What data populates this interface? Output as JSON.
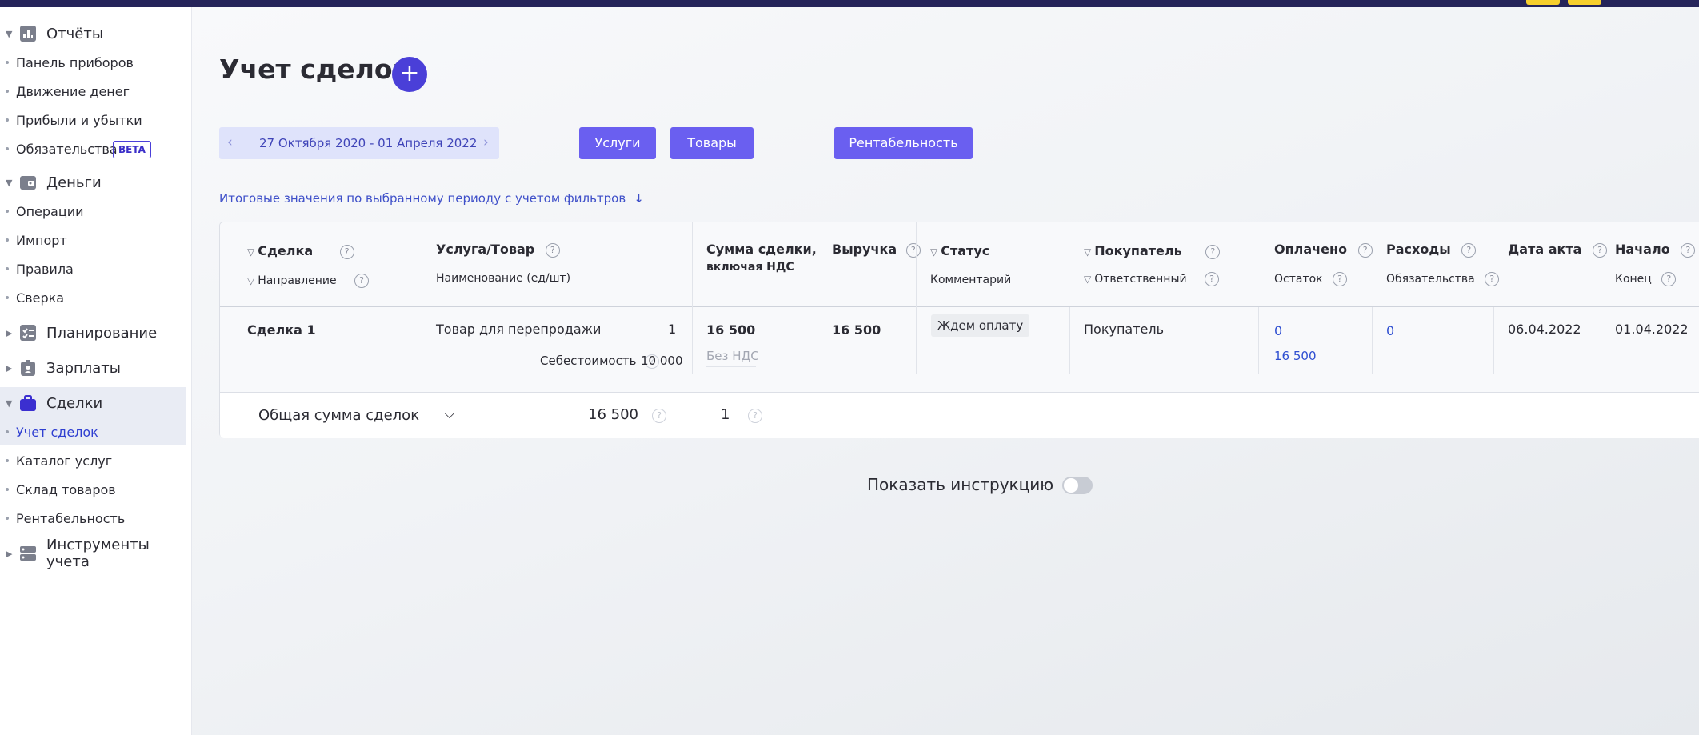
{
  "sidebar": {
    "groups": [
      {
        "label": "Отчёты",
        "icon": "bar-chart-icon"
      },
      {
        "label": "Деньги",
        "icon": "wallet-icon"
      },
      {
        "label": "Планирование",
        "icon": "plan-icon"
      },
      {
        "label": "Зарплаты",
        "icon": "badge-icon"
      },
      {
        "label": "Сделки",
        "icon": "briefcase-icon"
      },
      {
        "label": "Инструменты учета",
        "icon": "server-icon"
      }
    ],
    "reports_items": [
      "Панель приборов",
      "Движение денег",
      "Прибыли и убытки",
      "Обязательства"
    ],
    "beta_badge": "BETA",
    "money_items": [
      "Операции",
      "Импорт",
      "Правила",
      "Сверка"
    ],
    "deals_items": [
      "Учет сделок",
      "Каталог услуг",
      "Склад товаров",
      "Рентабельность"
    ]
  },
  "header": {
    "title": "Учет сделок",
    "add_label": "+"
  },
  "filters": {
    "date_range": "27 Октября 2020 - 01 Апреля 2022",
    "prev_arrow": "‹",
    "next_arrow": "›",
    "services_button": "Услуги",
    "goods_button": "Товары",
    "profitability_button": "Рентабельность",
    "summary_link": "Итоговые значения по выбранному периоду с учетом фильтров",
    "summary_arrow": "↓"
  },
  "table": {
    "headers": {
      "deal": "Сделка",
      "direction": "Направление",
      "service": "Услуга/Товар",
      "name_unit": "Наименование (ед/шт)",
      "sum_line1": "Сумма сделки,",
      "sum_line2": "включая НДС",
      "revenue": "Выручка",
      "status": "Статус",
      "comment": "Комментарий",
      "buyer": "Покупатель",
      "responsible": "Ответственный",
      "paid": "Оплачено",
      "remaining": "Остаток",
      "expenses": "Расходы",
      "obligations": "Обязательства",
      "act_date": "Дата акта",
      "start": "Начало",
      "end": "Конец"
    },
    "rows": [
      {
        "deal": "Сделка 1",
        "item": "Товар для перепродажи",
        "qty": "1",
        "cost_label": "Себестоимость",
        "cost": "10 000",
        "sum": "16 500",
        "vat": "Без НДС",
        "revenue": "16 500",
        "status": "Ждем оплату",
        "buyer": "Покупатель",
        "paid": "0",
        "remaining": "16 500",
        "expenses": "0",
        "act_date": "06.04.2022",
        "start": "01.04.2022"
      }
    ],
    "totals": {
      "label": "Общая сумма сделок",
      "sum": "16 500",
      "count": "1"
    }
  },
  "instruction": {
    "label": "Показать инструкцию",
    "enabled": false
  },
  "colors": {
    "accent": "#4a3fd8",
    "pill": "#6a5ff0",
    "link": "#2f4fd1",
    "topbar": "#25245a"
  }
}
